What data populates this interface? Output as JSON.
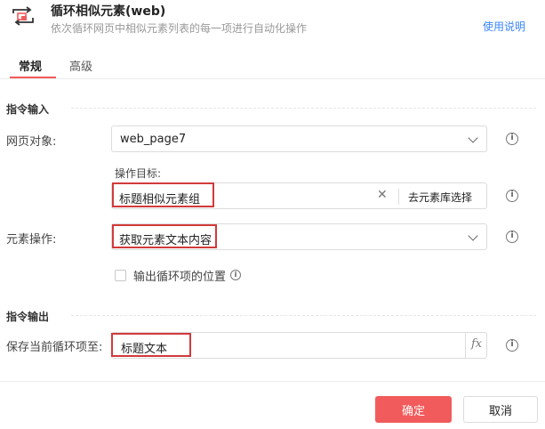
{
  "header": {
    "title": "循环相似元素(web)",
    "description": "依次循环网页中相似元素列表的每一项进行自动化操作",
    "help_link": "使用说明",
    "icon": "loop-icon"
  },
  "tabs": [
    {
      "label": "常规",
      "active": true
    },
    {
      "label": "高级",
      "active": false
    }
  ],
  "input_section": {
    "title": "指令输入",
    "web_object": {
      "label": "网页对象:",
      "value": "web_page7"
    },
    "target": {
      "label": "操作目标:",
      "value": "标题相似元素组",
      "library_button": "去元素库选择"
    },
    "element_action": {
      "label": "元素操作:",
      "value": "获取元素文本内容"
    },
    "output_loop_position": {
      "label": "输出循环项的位置",
      "checked": false
    }
  },
  "output_section": {
    "title": "指令输出",
    "save_current": {
      "label": "保存当前循环项至:",
      "value": "标题文本"
    }
  },
  "footer": {
    "ok_label": "确定",
    "cancel_label": "取消"
  },
  "colors": {
    "accent": "#f25b5b",
    "link": "#3a86ff",
    "highlight_border": "#d23a3a"
  }
}
